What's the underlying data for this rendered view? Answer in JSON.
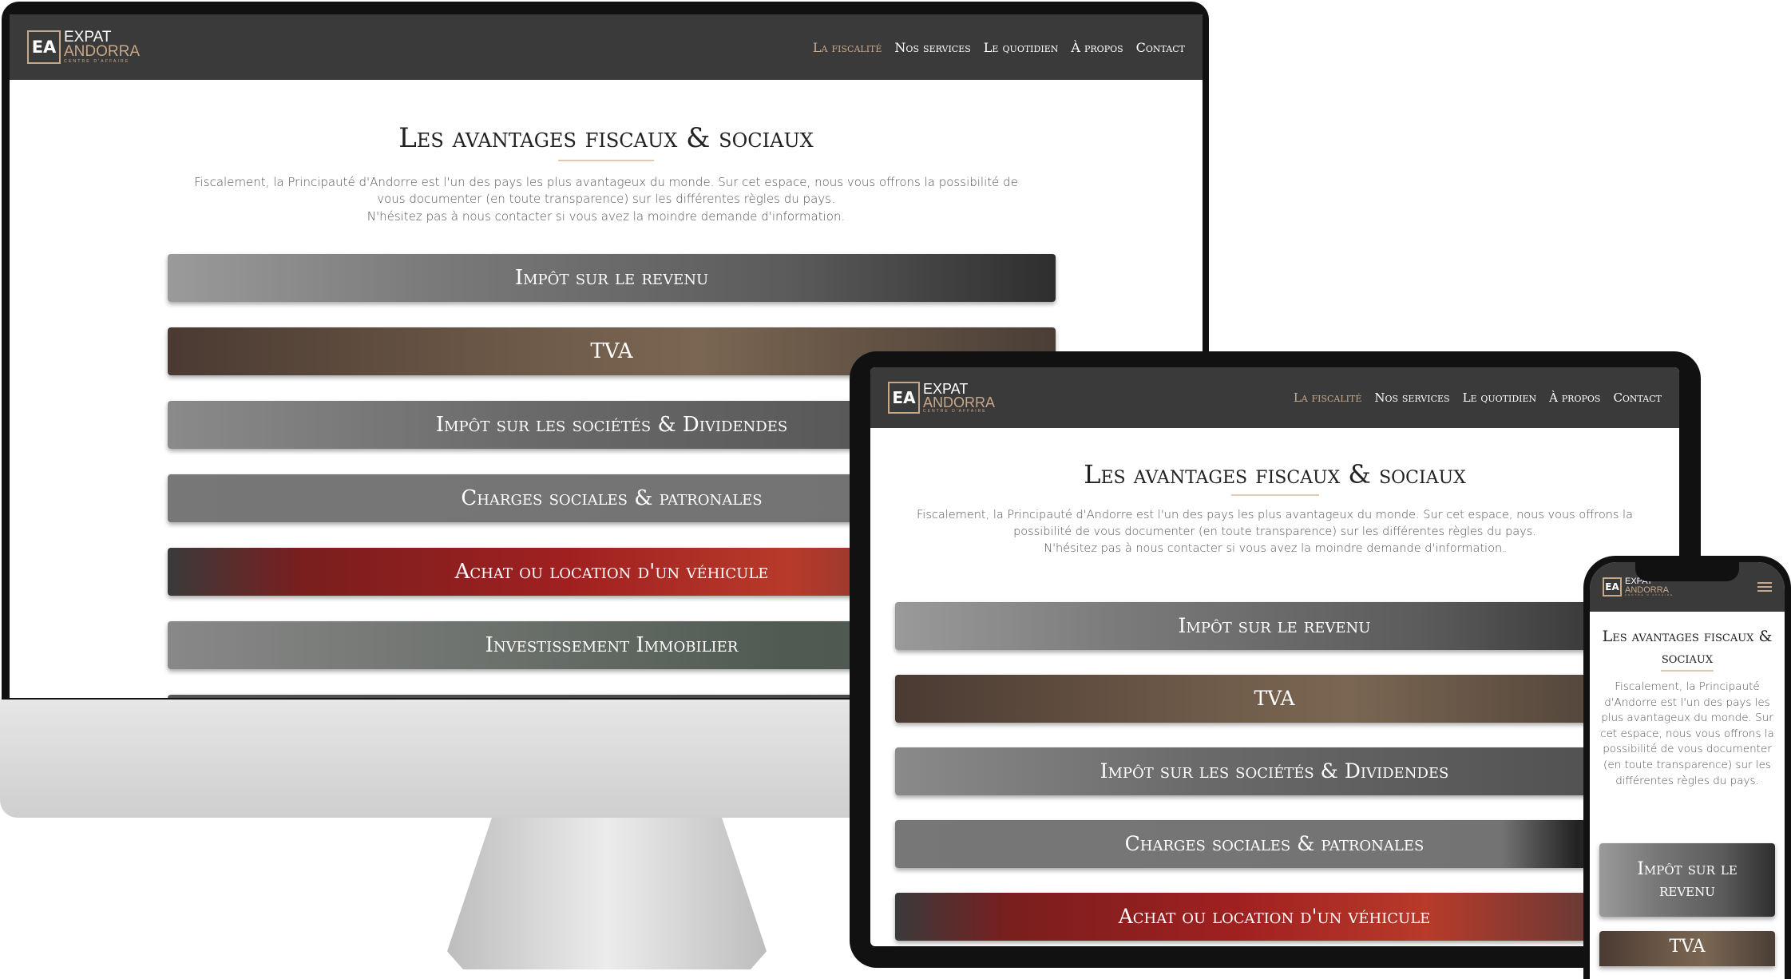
{
  "logo": {
    "line1": "EXPAT",
    "line2": "ANDORRA",
    "line3": "CENTRE D'AFFAIRE",
    "mark": "EA"
  },
  "nav": [
    {
      "label": "La fiscalité",
      "active": true
    },
    {
      "label": "Nos services"
    },
    {
      "label": "Le quotidien"
    },
    {
      "label": "À propos"
    },
    {
      "label": "Contact"
    }
  ],
  "page": {
    "title": "Les avantages fiscaux & sociaux",
    "intro": "Fiscalement, la Principauté d'Andorre est l'un des pays les plus avantageux du monde. Sur cet espace, nous vous offrons la possibilité de vous documenter (en toute transparence) sur les différentes règles du pays.",
    "intro2": "N'hésitez pas à nous contacter si vous avez la moindre demande d'information."
  },
  "bars": [
    {
      "label": "Impôt sur le revenu"
    },
    {
      "label": "TVA"
    },
    {
      "label": "Impôt sur les sociétés & Dividendes"
    },
    {
      "label": "Charges sociales & patronales"
    },
    {
      "label": "Achat ou location d'un véhicule"
    },
    {
      "label": "Investissement Immobilier"
    },
    {
      "label": ""
    }
  ],
  "colors": {
    "header": "#3a3a3a",
    "accent": "#c9a88a"
  },
  "icons": {
    "menu": "hamburger-icon"
  }
}
